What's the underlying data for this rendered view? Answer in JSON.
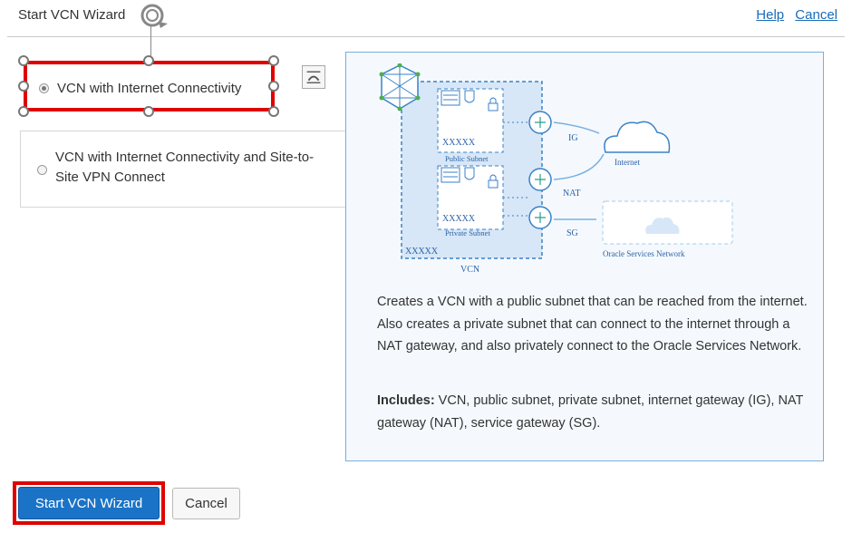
{
  "header": {
    "title": "Start VCN Wizard",
    "help_link": "Help",
    "cancel_link": "Cancel"
  },
  "options": [
    {
      "label": "VCN with Internet Connectivity",
      "selected": true
    },
    {
      "label": "VCN with Internet Connectivity and Site-to-Site VPN Connect",
      "selected": false
    }
  ],
  "diagram": {
    "public_subnet_cidr": "XXXXX",
    "public_subnet_label": "Public Subnet",
    "private_subnet_cidr": "XXXXX",
    "private_subnet_label": "Private Subnet",
    "vcn_cidr": "XXXXX",
    "vcn_label": "VCN",
    "ig_label": "IG",
    "nat_label": "NAT",
    "sg_label": "SG",
    "internet_label": "Internet",
    "oracle_services_label": "Oracle Services Network"
  },
  "description": "Creates a VCN with a public subnet that can be reached from the internet. Also creates a private subnet that can connect to the internet through a NAT gateway, and also privately connect to the Oracle Services Network.",
  "includes": {
    "heading": "Includes:",
    "text": " VCN, public subnet, private subnet, internet gateway (IG), NAT gateway (NAT), service gateway (SG)."
  },
  "footer": {
    "start_button": "Start VCN Wizard",
    "cancel_button": "Cancel"
  },
  "colors": {
    "accent": "#1a73c6",
    "selection": "#e00000",
    "link": "#1a6bb8"
  }
}
